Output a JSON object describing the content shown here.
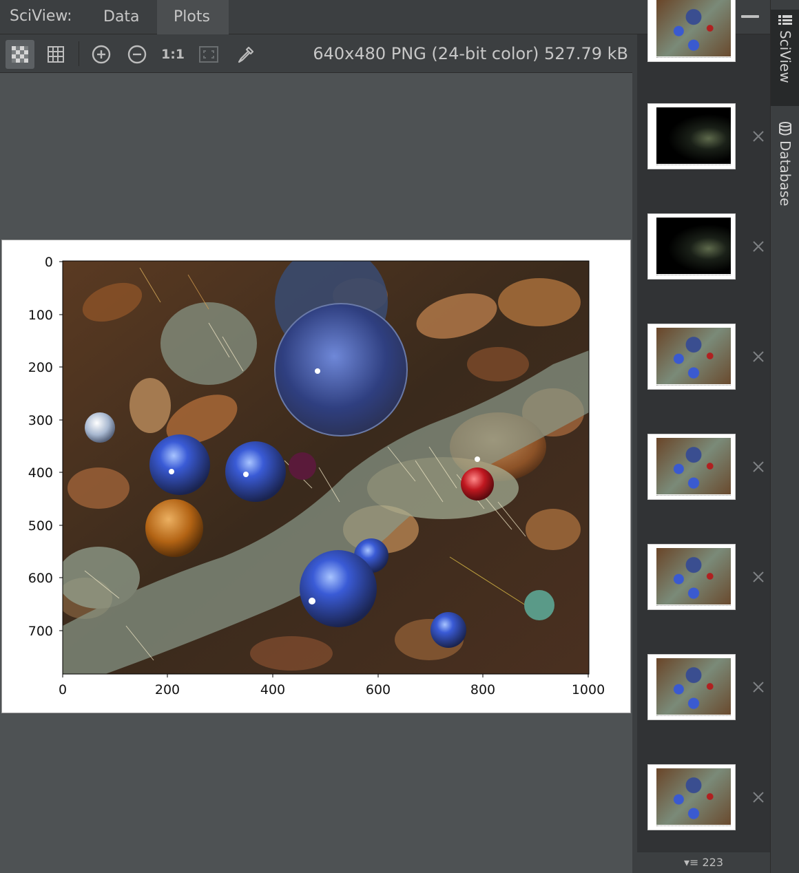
{
  "topbar": {
    "app_label": "SciView:",
    "tabs": [
      {
        "label": "Data"
      },
      {
        "label": "Plots",
        "active": true
      }
    ]
  },
  "toolbar": {
    "buttons": [
      "chessboard-icon",
      "grid-icon",
      "zoom-in-icon",
      "zoom-out-icon",
      "actual-size",
      "fit-to-window-icon",
      "color-picker-icon"
    ],
    "actual_size_label": "1:1",
    "image_info": "640x480 PNG (24-bit color) 527.79 kB"
  },
  "plot": {
    "y_ticks": [
      "0",
      "100",
      "200",
      "300",
      "400",
      "500",
      "600",
      "700"
    ],
    "x_ticks": [
      "0",
      "200",
      "400",
      "600",
      "800",
      "1000"
    ]
  },
  "thumbnails": {
    "count_label": "223",
    "items": [
      {
        "kind": "photo"
      },
      {
        "kind": "dark"
      },
      {
        "kind": "dark"
      },
      {
        "kind": "photo"
      },
      {
        "kind": "photo"
      },
      {
        "kind": "photo"
      },
      {
        "kind": "photo"
      },
      {
        "kind": "photo"
      }
    ]
  },
  "sidebar": {
    "tabs": [
      {
        "label": "SciView",
        "icon": "sciview-icon",
        "active": true
      },
      {
        "label": "Database",
        "icon": "database-icon"
      }
    ]
  },
  "colors": {
    "background": "#4e5254",
    "panel": "#3c3f41",
    "strip": "#313335",
    "text": "#c7c7c7"
  }
}
